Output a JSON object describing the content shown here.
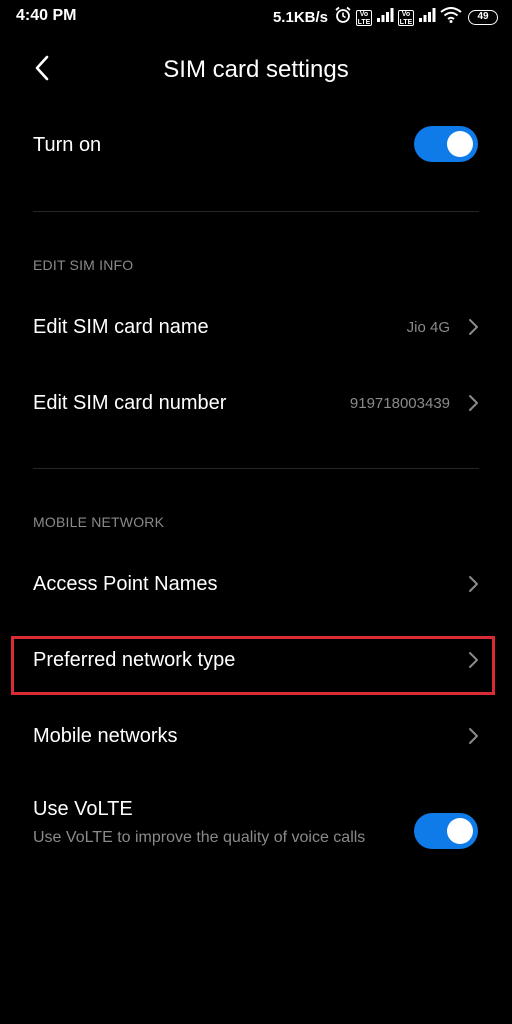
{
  "status_bar": {
    "time": "4:40 PM",
    "speed": "5.1KB/s",
    "volte_label_1": "Vo LTE",
    "volte_label_2": "Vo LTE",
    "battery": "49"
  },
  "header": {
    "title": "SIM card settings",
    "back_icon": "back-arrow-icon"
  },
  "turn_on": {
    "label": "Turn on",
    "state": "on"
  },
  "sections": {
    "edit_sim_info": "EDIT SIM INFO",
    "mobile_network": "MOBILE NETWORK"
  },
  "rows": {
    "sim_name": {
      "label": "Edit SIM card name",
      "value": "Jio 4G"
    },
    "sim_number": {
      "label": "Edit SIM card number",
      "value": "919718003439"
    },
    "apn": {
      "label": "Access Point Names"
    },
    "preferred_network": {
      "label": "Preferred network type"
    },
    "mobile_networks": {
      "label": "Mobile networks"
    }
  },
  "volte": {
    "label": "Use VoLTE",
    "description": "Use VoLTE to improve the quality of voice calls",
    "state": "on"
  },
  "colors": {
    "accent": "#0f7be8",
    "highlight": "#d92b33",
    "secondary_text": "#8a8a8a"
  }
}
